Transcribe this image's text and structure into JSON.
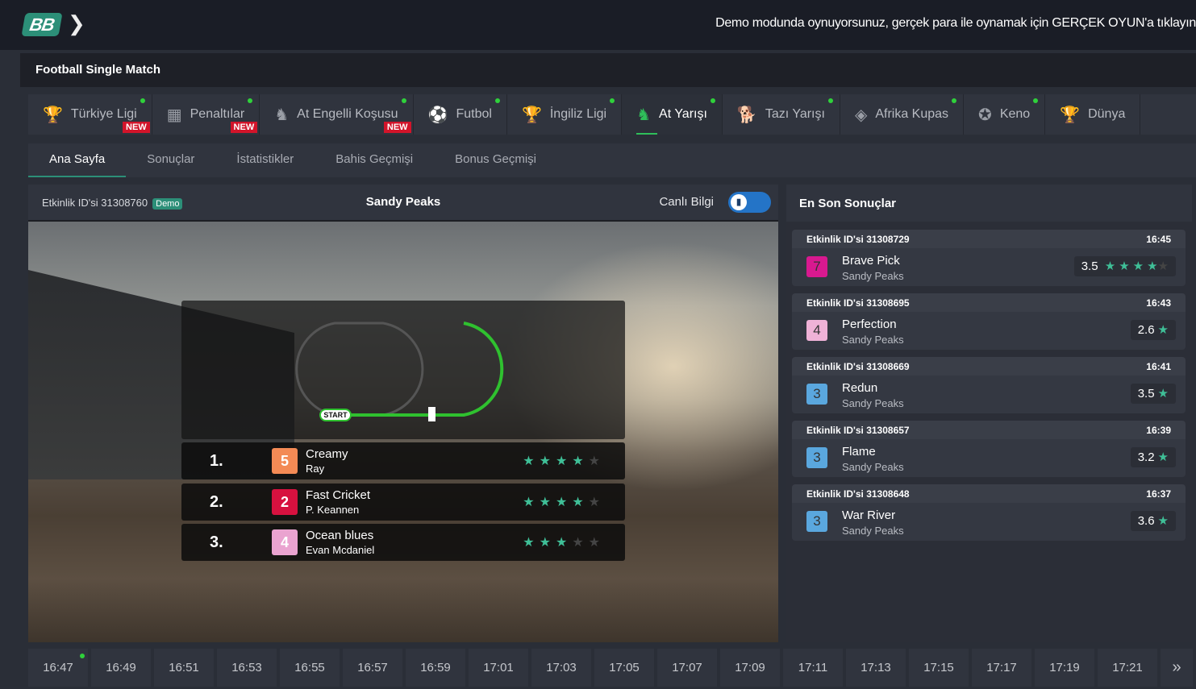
{
  "header": {
    "logo": "BB",
    "demo_message": "Demo modunda oynuyorsunuz, gerçek para ile oynamak için GERÇEK OYUN'a tıklayın"
  },
  "title": "Football Single Match",
  "game_tabs": [
    {
      "label": "Türkiye Ligi",
      "icon": "trophy-icon",
      "glyph": "🏆",
      "new": "NEW",
      "live": true
    },
    {
      "label": "Penaltılar",
      "icon": "goal-icon",
      "glyph": "▦",
      "new": "NEW",
      "live": true
    },
    {
      "label": "At Engelli Koşusu",
      "icon": "horse-jump-icon",
      "glyph": "♞",
      "new": "NEW",
      "live": true
    },
    {
      "label": "Futbol",
      "icon": "soccer-ball-icon",
      "glyph": "⚽",
      "live": true
    },
    {
      "label": "İngiliz Ligi",
      "icon": "trophy-icon",
      "glyph": "🏆",
      "live": true
    },
    {
      "label": "At Yarışı",
      "icon": "horse-icon",
      "glyph": "♞",
      "live": true,
      "active": true
    },
    {
      "label": "Tazı Yarışı",
      "icon": "greyhound-icon",
      "glyph": "🐕",
      "live": true
    },
    {
      "label": "Afrika Kupas",
      "icon": "africa-icon",
      "glyph": "◈",
      "live": true
    },
    {
      "label": "Keno",
      "icon": "keno-icon",
      "glyph": "✪",
      "live": true
    },
    {
      "label": "Dünya",
      "icon": "trophy-icon",
      "glyph": "🏆"
    }
  ],
  "subnav": [
    "Ana Sayfa",
    "Sonuçlar",
    "İstatistikler",
    "Bahis Geçmişi",
    "Bonus Geçmişi"
  ],
  "event": {
    "id_label": "Etkinlik ID'si 31308760",
    "badge": "Demo",
    "race": "Sandy Peaks",
    "live_label": "Canlı Bilgi",
    "start_label": "START"
  },
  "results": [
    {
      "pos": "1.",
      "number": "5",
      "color": "#f38a55",
      "horse": "Creamy",
      "jockey": "Ray",
      "rating": 3.5
    },
    {
      "pos": "2.",
      "number": "2",
      "color": "#d7113f",
      "horse": "Fast Cricket",
      "jockey": "P. Keannen",
      "rating": 3.5
    },
    {
      "pos": "3.",
      "number": "4",
      "color": "#eaa3d0",
      "horse": "Ocean blues",
      "jockey": "Evan Mcdaniel",
      "rating": 3
    }
  ],
  "latest": {
    "title": "En Son Sonuçlar",
    "items": [
      {
        "event": "Etkinlik ID'si 31308729",
        "time": "16:45",
        "number": "7",
        "color": "#d8198f",
        "horse": "Brave Pick",
        "track": "Sandy Peaks",
        "rating": "3.5"
      },
      {
        "event": "Etkinlik ID'si 31308695",
        "time": "16:43",
        "number": "4",
        "color": "#efb2d7",
        "horse": "Perfection",
        "track": "Sandy Peaks",
        "rating": "2.6"
      },
      {
        "event": "Etkinlik ID'si 31308669",
        "time": "16:41",
        "number": "3",
        "color": "#5aa7de",
        "horse": "Redun",
        "track": "Sandy Peaks",
        "rating": "3.5"
      },
      {
        "event": "Etkinlik ID'si 31308657",
        "time": "16:39",
        "number": "3",
        "color": "#5aa7de",
        "horse": "Flame",
        "track": "Sandy Peaks",
        "rating": "3.2"
      },
      {
        "event": "Etkinlik ID'si 31308648",
        "time": "16:37",
        "number": "3",
        "color": "#5aa7de",
        "horse": "War River",
        "track": "Sandy Peaks",
        "rating": "3.6"
      }
    ]
  },
  "times": [
    "16:47",
    "16:49",
    "16:51",
    "16:53",
    "16:55",
    "16:57",
    "16:59",
    "17:01",
    "17:03",
    "17:05",
    "17:07",
    "17:09",
    "17:11",
    "17:13",
    "17:15",
    "17:17",
    "17:19",
    "17:21"
  ],
  "next_label": "»"
}
